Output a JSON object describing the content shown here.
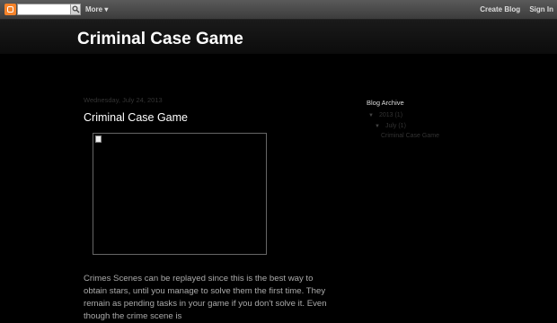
{
  "navbar": {
    "more_label": "More ▾",
    "create_blog": "Create Blog",
    "sign_in": "Sign In"
  },
  "blog": {
    "title": "Criminal Case Game"
  },
  "post": {
    "date": "Wednesday, July 24, 2013",
    "title": "Criminal Case Game",
    "body": "Crimes Scenes can be replayed since this is the best way to obtain stars, until you manage to solve them the first time. They remain as pending tasks in your game if you don't solve it. Even though the crime scene is"
  },
  "sidebar": {
    "title": "Blog Archive",
    "year": "2013 (1)",
    "month": "July (1)",
    "post": "Criminal Case Game"
  },
  "colors": {
    "blogger_orange": "#f5832a",
    "background": "#000000"
  }
}
